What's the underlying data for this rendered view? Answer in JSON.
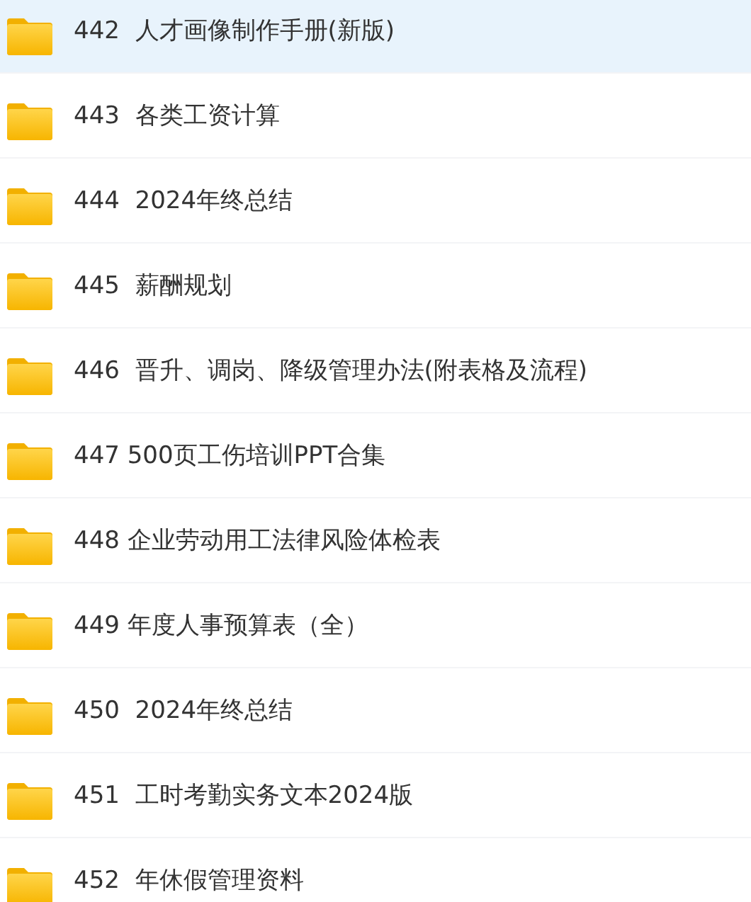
{
  "files": [
    {
      "name": "442  人才画像制作手册(新版)",
      "selected": true
    },
    {
      "name": "443  各类工资计算",
      "selected": false
    },
    {
      "name": "444  2024年终总结",
      "selected": false
    },
    {
      "name": "445  薪酬规划",
      "selected": false
    },
    {
      "name": "446  晋升、调岗、降级管理办法(附表格及流程)",
      "selected": false
    },
    {
      "name": "447 500页工伤培训PPT合集",
      "selected": false
    },
    {
      "name": "448 企业劳动用工法律风险体检表",
      "selected": false
    },
    {
      "name": "449 年度人事预算表（全）",
      "selected": false
    },
    {
      "name": "450  2024年终总结",
      "selected": false
    },
    {
      "name": "451  工时考勤实务文本2024版",
      "selected": false
    },
    {
      "name": "452  年休假管理资料",
      "selected": false
    }
  ]
}
